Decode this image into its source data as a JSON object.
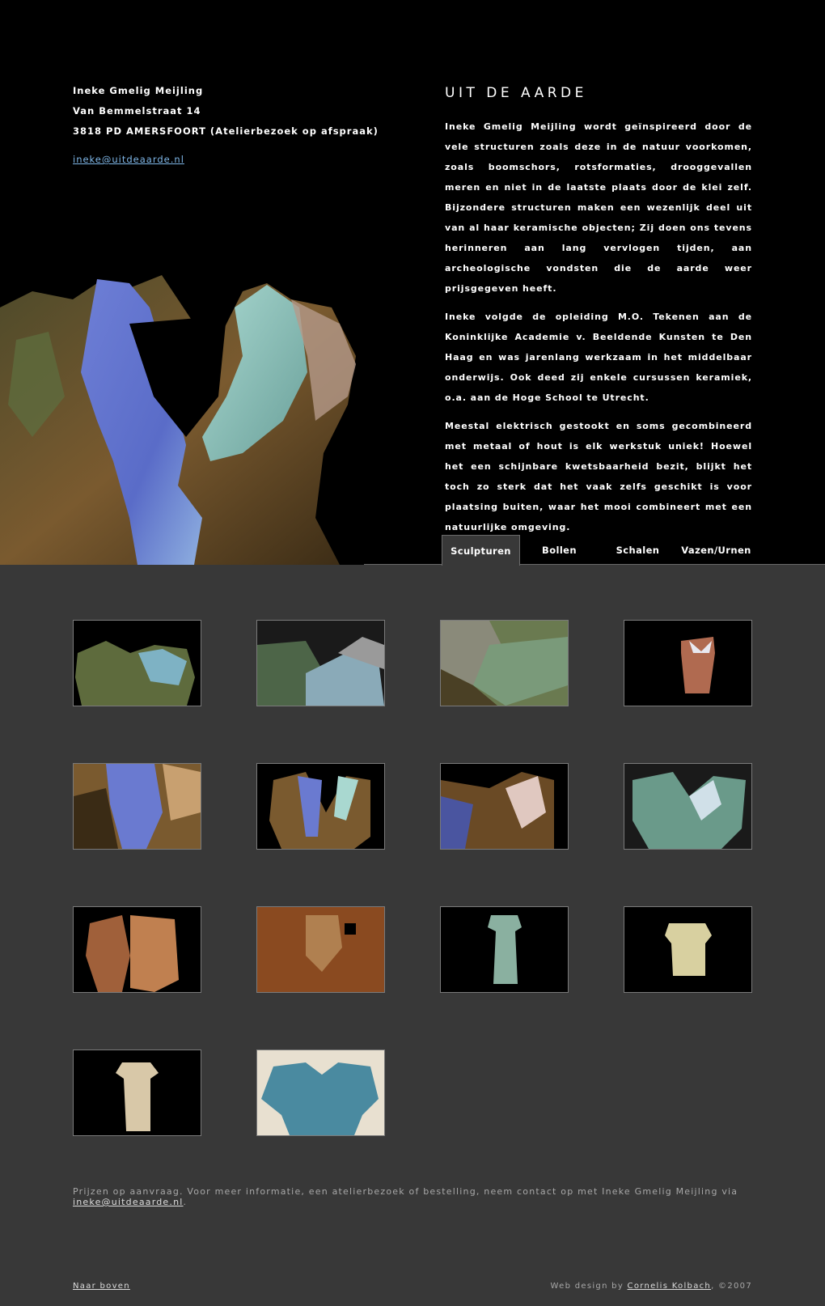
{
  "contact": {
    "name": "Ineke Gmelig Meijling",
    "street": "Van Bemmelstraat 14",
    "city": "3818 PD AMERSFOORT (Atelierbezoek op afspraak)",
    "email": "ineke@uitdeaarde.nl"
  },
  "intro": {
    "title": "UIT DE AARDE",
    "paragraphs": [
      "Ineke Gmelig Meijling wordt geïnspireerd door de vele structuren zoals deze in de natuur voorkomen, zoals boomschors, rotsformaties, drooggevallen meren en niet in de laatste plaats door de klei zelf. Bijzondere structuren maken een wezenlijk deel uit van al haar keramische objecten; Zij doen ons tevens herinneren aan lang vervlogen tijden, aan archeologische vondsten die de aarde weer prijsgegeven heeft.",
      "Ineke volgde de opleiding M.O. Tekenen aan de Koninklijke Academie v. Beeldende Kunsten te Den Haag en was jarenlang werkzaam in het middelbaar onderwijs. Ook deed zij enkele cursussen keramiek, o.a. aan de Hoge School te Utrecht.",
      "Meestal elektrisch gestookt en soms gecombineerd met metaal of hout is elk werkstuk uniek! Hoewel het een schijnbare kwetsbaarheid bezit, blijkt het toch zo sterk dat het vaak zelfs geschikt is voor plaatsing buiten, waar het mooi combineert met een natuurlijke omgeving."
    ]
  },
  "tabs": [
    {
      "label": "Sculpturen",
      "active": true
    },
    {
      "label": "Bollen",
      "active": false
    },
    {
      "label": "Schalen",
      "active": false
    },
    {
      "label": "Vazen/Urnen",
      "active": false
    }
  ],
  "gallery": {
    "count": 14
  },
  "info": {
    "text": "Prijzen op aanvraag. Voor meer informatie, een atelierbezoek of bestelling, neem contact op met Ineke Gmelig Meijling via ",
    "email": "ineke@uitdeaarde.nl",
    "suffix": "."
  },
  "footer": {
    "top_link": "Naar boven",
    "credit_prefix": "Web design by ",
    "credit_name": "Cornelis Kolbach",
    "credit_suffix": ", ©2007"
  },
  "colors": {
    "header_bg": "#000000",
    "body_bg": "#383838",
    "link_blue": "#7fb7e8"
  }
}
